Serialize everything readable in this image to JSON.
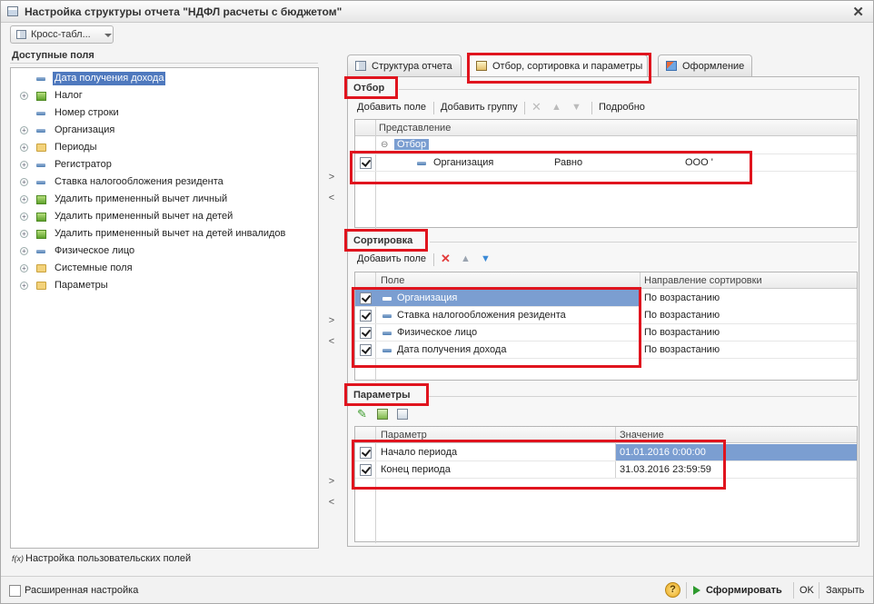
{
  "window": {
    "title": "Настройка структуры отчета \"НДФЛ расчеты с бюджетом\"",
    "close": "✕"
  },
  "variant": {
    "label": "Кросс-табл..."
  },
  "available": {
    "title": "Доступные поля",
    "items": [
      {
        "label": "Дата получения дохода",
        "icon": "field-icon",
        "expandable": false,
        "selected": true
      },
      {
        "label": "Налог",
        "icon": "resource-icon",
        "expandable": true
      },
      {
        "label": "Номер строки",
        "icon": "field-icon",
        "expandable": false
      },
      {
        "label": "Организация",
        "icon": "field-icon",
        "expandable": true
      },
      {
        "label": "Периоды",
        "icon": "folder-icon",
        "expandable": true
      },
      {
        "label": "Регистратор",
        "icon": "field-icon",
        "expandable": true
      },
      {
        "label": "Ставка налогообложения резидента",
        "icon": "field-icon",
        "expandable": true
      },
      {
        "label": "Удалить примененный вычет личный",
        "icon": "resource-icon",
        "expandable": true
      },
      {
        "label": "Удалить примененный вычет на детей",
        "icon": "resource-icon",
        "expandable": true
      },
      {
        "label": "Удалить примененный вычет на детей инвалидов",
        "icon": "resource-icon",
        "expandable": true
      },
      {
        "label": "Физическое лицо",
        "icon": "field-icon",
        "expandable": true
      },
      {
        "label": "Системные поля",
        "icon": "folder-icon",
        "expandable": true
      },
      {
        "label": "Параметры",
        "icon": "folder-icon",
        "expandable": true
      }
    ],
    "custom_fields": "Настройка пользовательских полей",
    "fx": "f(x)"
  },
  "move": {
    "right": ">",
    "left": "<"
  },
  "tabs": [
    {
      "label": "Структура отчета"
    },
    {
      "label": "Отбор, сортировка и параметры",
      "active": true
    },
    {
      "label": "Оформление"
    }
  ],
  "filter": {
    "title": "Отбор",
    "toolbar": {
      "add_field": "Добавить поле",
      "add_group": "Добавить группу",
      "details": "Подробно"
    },
    "header": "Представление",
    "root": "Отбор",
    "root_exp": "⊖",
    "rows": [
      {
        "field": "Организация",
        "condition": "Равно",
        "value": "ООО '"
      }
    ]
  },
  "sort": {
    "title": "Сортировка",
    "toolbar": {
      "add_field": "Добавить поле"
    },
    "headers": [
      "Поле",
      "Направление сортировки"
    ],
    "rows": [
      {
        "field": "Организация",
        "direction": "По возрастанию"
      },
      {
        "field": "Ставка налогообложения резидента",
        "direction": "По возрастанию"
      },
      {
        "field": "Физическое лицо",
        "direction": "По возрастанию"
      },
      {
        "field": "Дата получения дохода",
        "direction": "По возрастанию"
      }
    ]
  },
  "params": {
    "title": "Параметры",
    "headers": [
      "Параметр",
      "Значение"
    ],
    "rows": [
      {
        "name": "Начало периода",
        "value": "01.01.2016 0:00:00"
      },
      {
        "name": "Конец периода",
        "value": "31.03.2016 23:59:59"
      }
    ]
  },
  "footer": {
    "advanced": "Расширенная настройка",
    "help": "?",
    "generate": "Сформировать",
    "ok": "OK",
    "close": "Закрыть"
  },
  "colors": {
    "accent": "#e0141e",
    "selection": "#4f79be",
    "row_highlight": "#7b9ed1"
  }
}
